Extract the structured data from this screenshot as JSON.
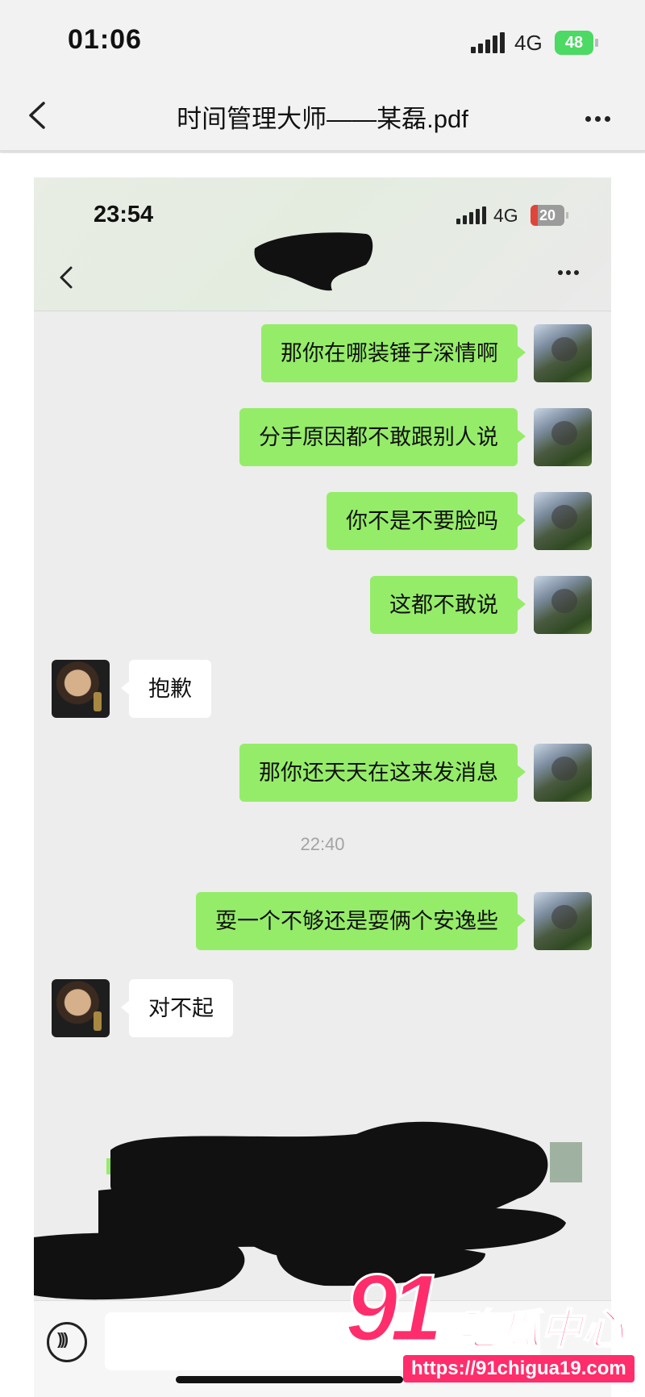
{
  "status_bar": {
    "time": "01:06",
    "network": "4G",
    "battery": "48"
  },
  "nav": {
    "title": "时间管理大师——某磊.pdf"
  },
  "inner_screenshot": {
    "status_bar": {
      "time": "23:54",
      "network": "4G",
      "battery": "20"
    },
    "messages": [
      {
        "side": "right",
        "text": "那你在哪装锤子深情啊"
      },
      {
        "side": "right",
        "text": "分手原因都不敢跟别人说"
      },
      {
        "side": "right",
        "text": "你不是不要脸吗"
      },
      {
        "side": "right",
        "text": "这都不敢说"
      },
      {
        "side": "left",
        "text": "抱歉"
      },
      {
        "side": "right",
        "text": "那你还天天在这来发消息"
      },
      {
        "side": "time",
        "text": "22:40"
      },
      {
        "side": "right",
        "text": "耍一个不够还是耍俩个安逸些"
      },
      {
        "side": "left",
        "text": "对不起"
      }
    ]
  },
  "watermark": {
    "number": "91",
    "brand": "吃瓜中心",
    "url": "https://91chigua19.com"
  }
}
